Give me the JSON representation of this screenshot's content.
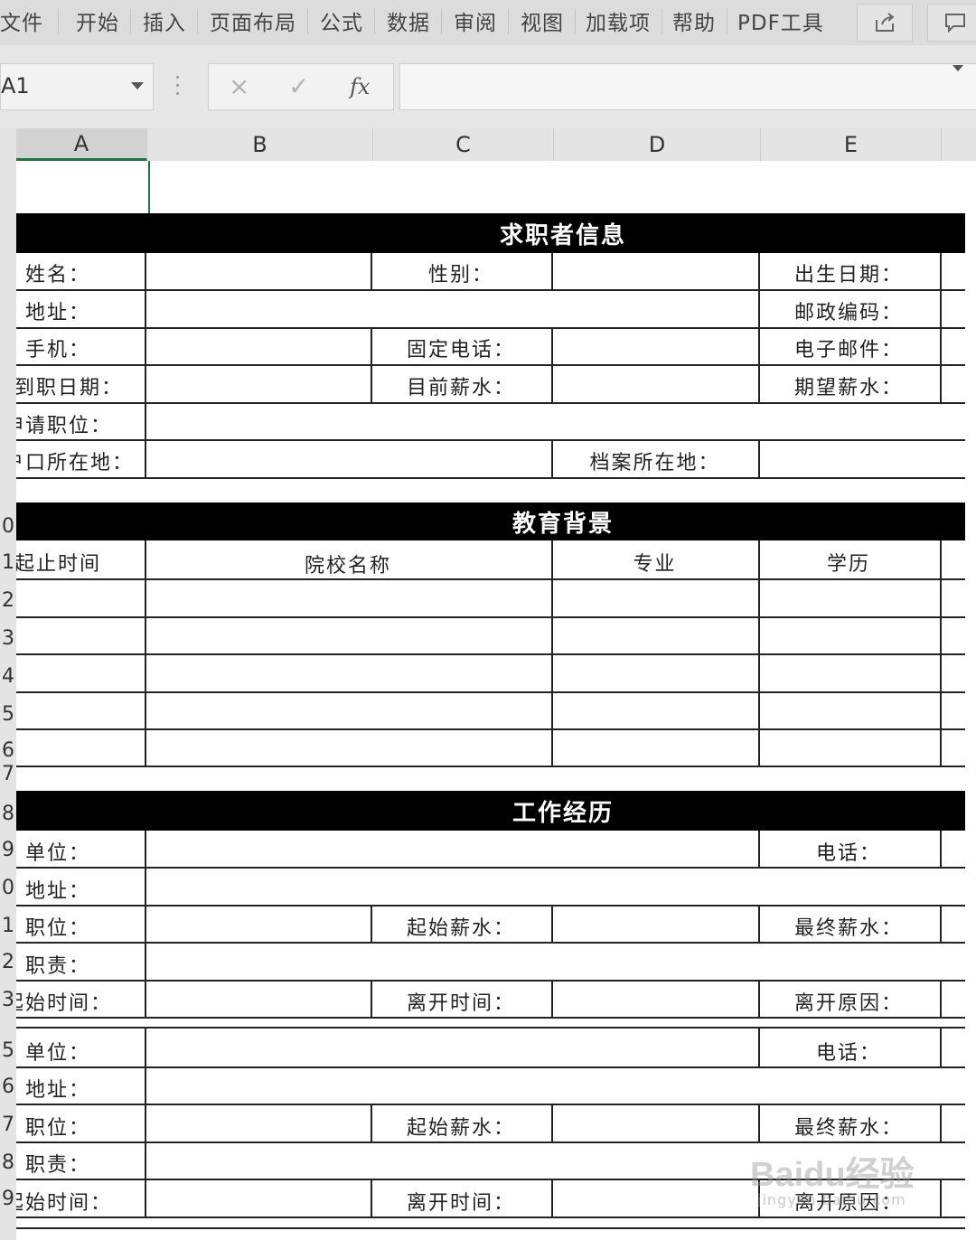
{
  "ribbon": {
    "tabs": [
      "文件",
      "开始",
      "插入",
      "页面布局",
      "公式",
      "数据",
      "审阅",
      "视图",
      "加载项",
      "帮助",
      "PDF工具"
    ]
  },
  "formula_bar": {
    "name_box": "A1",
    "cancel_icon": "×",
    "enter_icon": "✓",
    "fx_label": "fx",
    "value": ""
  },
  "columns": [
    "A",
    "B",
    "C",
    "D",
    "E"
  ],
  "rows": [
    "0",
    "1",
    "2",
    "3",
    "4",
    "5",
    "6",
    "7",
    "8",
    "9",
    "0",
    "1",
    "2",
    "3",
    "5",
    "6",
    "7",
    "8",
    "9"
  ],
  "sheet": {
    "section1": {
      "title": "求职者信息",
      "name": "姓名：",
      "gender": "性别：",
      "birth": "出生日期：",
      "address": "地址：",
      "postcode": "邮政编码：",
      "mobile": "手机：",
      "phone": "固定电话：",
      "email": "电子邮件：",
      "start_date": "到职日期：",
      "cur_salary": "目前薪水：",
      "exp_salary": "期望薪水：",
      "apply_pos": "申请职位：",
      "hukou": "户口所在地：",
      "archive": "档案所在地："
    },
    "section2": {
      "title": "教育背景",
      "h_time": "起止时间",
      "h_school": "院校名称",
      "h_major": "专业",
      "h_degree": "学历"
    },
    "section3": {
      "title": "工作经历",
      "unit": "单位：",
      "tel": "电话：",
      "address": "地址：",
      "position": "职位：",
      "start_salary": "起始薪水：",
      "final_salary": "最终薪水：",
      "duty": "职责：",
      "start_time": "起始时间：",
      "leave_time": "离开时间：",
      "leave_reason": "离开原因："
    }
  },
  "watermark": {
    "brand": "Baidu经验",
    "url": "jingyan.baidu.com"
  }
}
